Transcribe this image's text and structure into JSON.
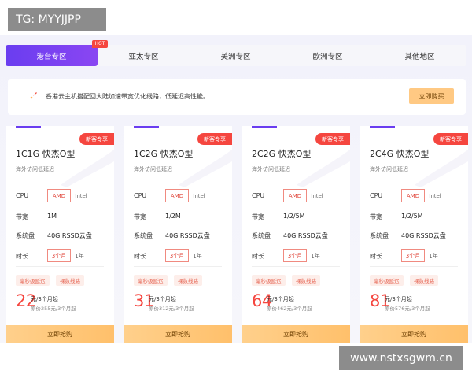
{
  "watermark": {
    "top": "TG: MYYJJPP",
    "bottom": "www.nstxsgwm.cn"
  },
  "tabs": [
    {
      "label": "港台专区",
      "active": true,
      "badge": "HOT"
    },
    {
      "label": "亚太专区"
    },
    {
      "label": "美洲专区"
    },
    {
      "label": "欧洲专区"
    },
    {
      "label": "其他地区"
    }
  ],
  "notice": {
    "text": "香港云主机搭配回大陆加速带宽优化线路，低延迟高性能。",
    "button": "立即购买"
  },
  "labels": {
    "cpu": "CPU",
    "bandwidth": "带宽",
    "disk": "系统盘",
    "duration": "时长"
  },
  "cards": [
    {
      "badge": "新客专享",
      "title": "1C1G 快杰O型",
      "subtitle": "海外访问低延迟",
      "cpu_options": [
        "AMD",
        "Intel"
      ],
      "bandwidth": "1M",
      "disk": "40G RSSD云盘",
      "duration_options": [
        "3个月",
        "1年"
      ],
      "tags": [
        "毫秒级延迟",
        "裸数线路"
      ],
      "price": "22",
      "price_unit": "元/3个月起",
      "original_price": "原价255元/3个月起",
      "button": "立即抢购"
    },
    {
      "badge": "新客专享",
      "title": "1C2G 快杰O型",
      "subtitle": "海外访问低延迟",
      "cpu_options": [
        "AMD",
        "Intel"
      ],
      "bandwidth": "1/2M",
      "disk": "40G RSSD云盘",
      "duration_options": [
        "3个月",
        "1年"
      ],
      "tags": [
        "毫秒级延迟",
        "裸数线路"
      ],
      "price": "31",
      "price_unit": "元/3个月起",
      "original_price": "原价312元/3个月起",
      "button": "立即抢购"
    },
    {
      "badge": "新客专享",
      "title": "2C2G 快杰O型",
      "subtitle": "海外访问低延迟",
      "cpu_options": [
        "AMD",
        "Intel"
      ],
      "bandwidth": "1/2/5M",
      "disk": "40G RSSD云盘",
      "duration_options": [
        "3个月",
        "1年"
      ],
      "tags": [
        "毫秒级延迟",
        "裸数线路"
      ],
      "price": "64",
      "price_unit": "元/3个月起",
      "original_price": "原价462元/3个月起",
      "button": "立即抢购"
    },
    {
      "badge": "新客专享",
      "title": "2C4G 快杰O型",
      "subtitle": "海外访问低延迟",
      "cpu_options": [
        "AMD",
        "Intel"
      ],
      "bandwidth": "1/2/5M",
      "disk": "40G RSSD云盘",
      "duration_options": [
        "3个月",
        "1年"
      ],
      "tags": [
        "毫秒级延迟",
        "裸数线路"
      ],
      "price": "81",
      "price_unit": "元/3个月起",
      "original_price": "原价576元/3个月起",
      "button": "立即抢购"
    }
  ],
  "colors": {
    "accent": "#6a3df0",
    "badge_red": "#f5463f",
    "buy_orange": "#ffc983"
  }
}
